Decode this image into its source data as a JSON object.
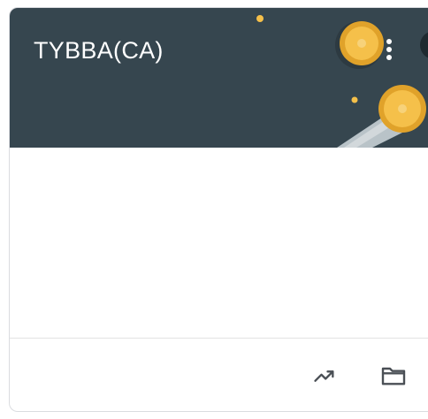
{
  "card": {
    "title": "TYBBA(CA)",
    "more_options_icon": "more-vert-icon",
    "footer": {
      "trend_icon": "trending-up-icon",
      "folder_icon": "folder-icon"
    }
  },
  "colors": {
    "banner": "#36464f",
    "coin": "#f5c04a",
    "coin_rim": "#e0a22a",
    "title_text": "#ffffff",
    "icon": "#4a4f55"
  }
}
